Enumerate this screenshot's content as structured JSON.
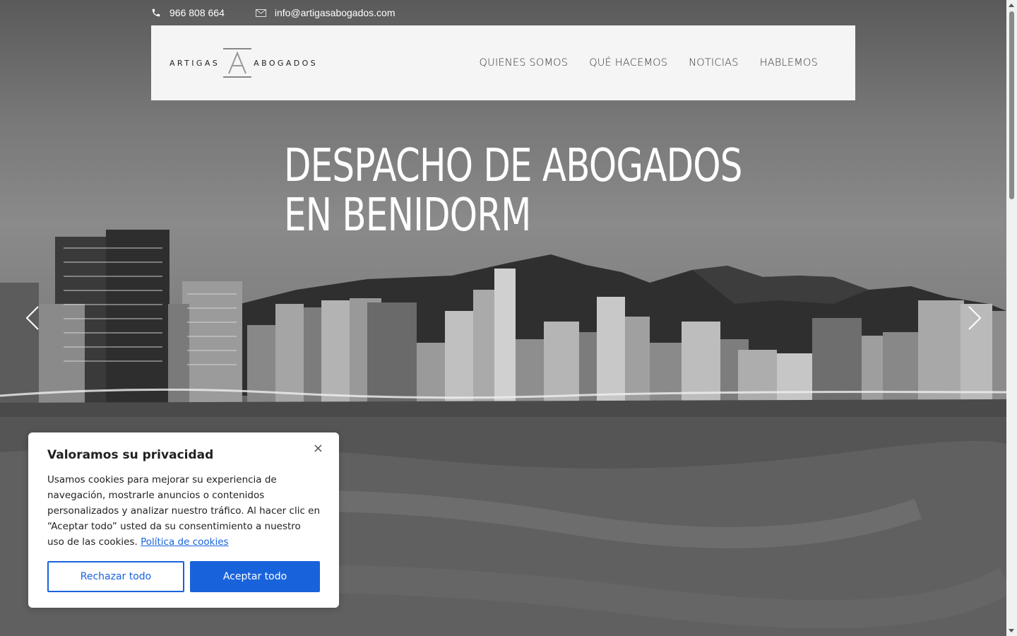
{
  "topbar": {
    "phone": "966 808 664",
    "email": "info@artigasabogados.com"
  },
  "logo": {
    "left": "ARTIGAS",
    "right": "ABOGADOS",
    "mark": "A"
  },
  "nav": {
    "items": [
      "QUIENES SOMOS",
      "QUÉ HACEMOS",
      "NOTICIAS",
      "HABLEMOS"
    ]
  },
  "hero": {
    "line1": "DESPACHO DE ABOGADOS",
    "line2": "EN BENIDORM"
  },
  "cookie": {
    "title": "Valoramos su privacidad",
    "body": "Usamos cookies para mejorar su experiencia de navegación, mostrarle anuncios o contenidos personalizados y analizar nuestro tráfico. Al hacer clic en “Aceptar todo” usted da su consentimiento a nuestro uso de las cookies.",
    "policy_link": "Política de cookies",
    "reject_label": "Rechazar todo",
    "accept_label": "Aceptar todo",
    "close_glyph": "×"
  },
  "colors": {
    "accent": "#1863dc",
    "header_bg": "#f5f5f5"
  }
}
